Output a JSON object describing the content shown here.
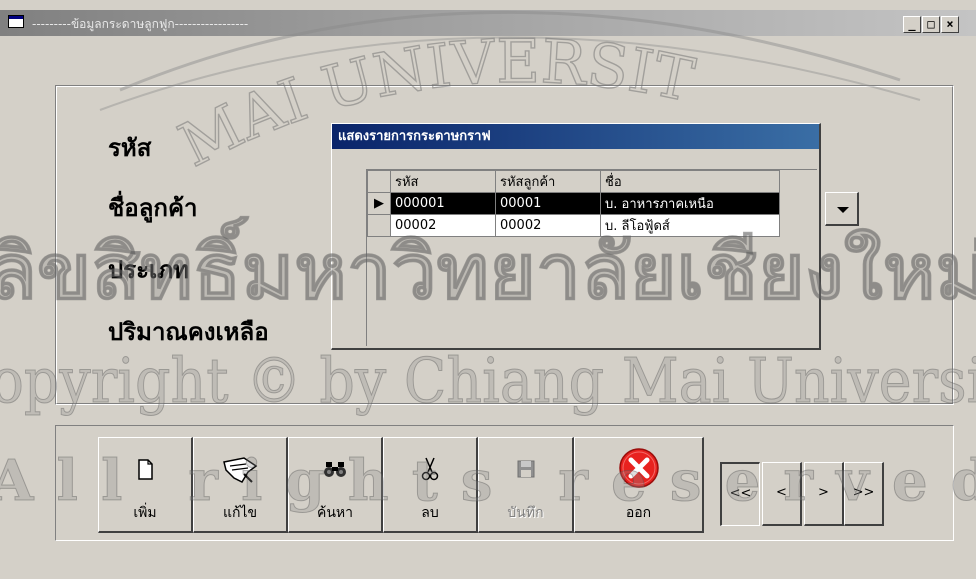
{
  "window": {
    "title": "---------ข้อมูลกระดาษลูกฟูก-----------------",
    "minimize": "_",
    "maximize": "□",
    "close": "×"
  },
  "form": {
    "labels": [
      "รหัส",
      "ชื่อลูกค้า",
      "ประเภท",
      "ปริมาณคงเหลือ"
    ]
  },
  "dialog": {
    "title": "แสดงรายการกระดาษกราฟ",
    "grid": {
      "columns": [
        "รหัส",
        "รหัสลูกค้า",
        "ชื่อ"
      ],
      "rows": [
        {
          "indicator": "▶",
          "cells": [
            "000001",
            "00001",
            "บ. อาหารภาคเหนือ"
          ],
          "selected": true
        },
        {
          "indicator": "",
          "cells": [
            "00002",
            "00002",
            "บ. ลีโอฟู้ดส์"
          ],
          "selected": false
        }
      ]
    }
  },
  "toolbar": {
    "add": "เพิ่ม",
    "edit": "แก้ไข",
    "search": "ค้นหา",
    "delete": "ลบ",
    "save": "บันทึก",
    "exit": "ออก"
  },
  "nav": {
    "first": "<<",
    "prev": "<",
    "next": ">",
    "last": ">>"
  },
  "watermark": {
    "arc_text": "MAI UNIVERSIT",
    "thai": "ลิขสิทธิ์มหาวิทยาลัยเชียงใหม่",
    "copyright": "Copyright © by Chiang Mai University",
    "rights": "All rights reserved"
  },
  "colors": {
    "face": "#d4d0c8",
    "titlebar_active": "#0a246a",
    "selection": "#000000",
    "exit_icon": "#e8221f"
  }
}
